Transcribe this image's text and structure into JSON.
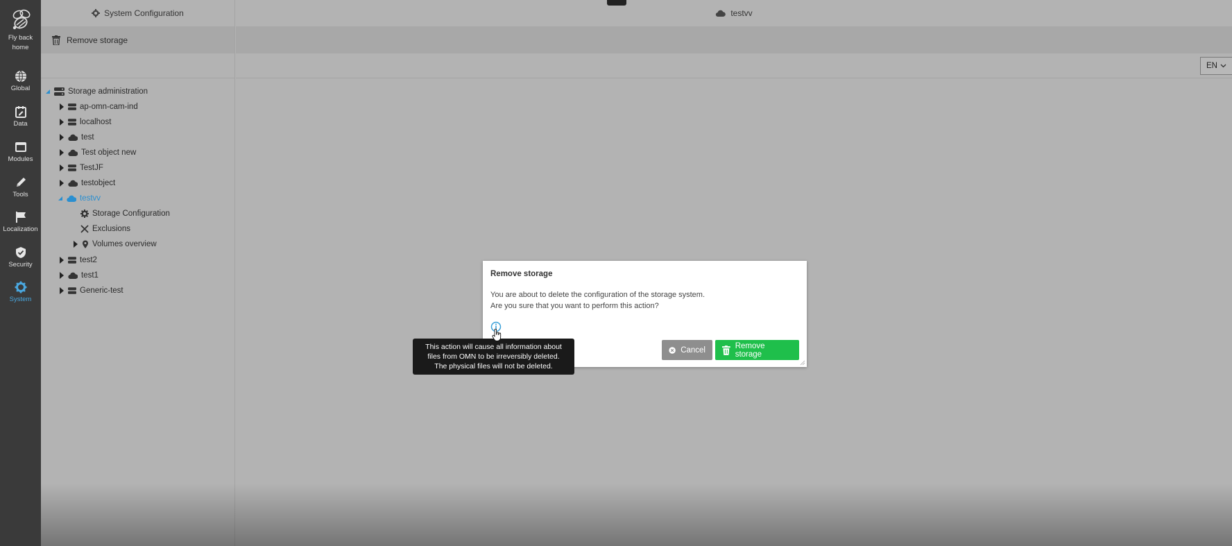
{
  "rail": {
    "logo_label": "Fly back home",
    "items": [
      {
        "label": "Global",
        "icon": "globe-icon"
      },
      {
        "label": "Data",
        "icon": "data-icon"
      },
      {
        "label": "Modules",
        "icon": "modules-icon"
      },
      {
        "label": "Tools",
        "icon": "pencil-icon"
      },
      {
        "label": "Localization",
        "icon": "flag-icon"
      },
      {
        "label": "Security",
        "icon": "shield-icon"
      },
      {
        "label": "System",
        "icon": "gear-icon"
      }
    ],
    "active": "System",
    "active_color": "#4aa8e0"
  },
  "left_panel": {
    "header_title": "System Configuration",
    "toolbar_action": "Remove storage",
    "tree": {
      "root": "Storage administration",
      "items": [
        {
          "label": "ap-omn-cam-ind",
          "icon": "server-icon"
        },
        {
          "label": "localhost",
          "icon": "server-icon"
        },
        {
          "label": "test",
          "icon": "cloud-icon"
        },
        {
          "label": "Test object new",
          "icon": "cloud-icon"
        },
        {
          "label": "TestJF",
          "icon": "server-icon"
        },
        {
          "label": "testobject",
          "icon": "cloud-icon"
        },
        {
          "label": "testvv",
          "icon": "cloud-icon",
          "selected": true,
          "children": [
            {
              "label": "Storage Configuration",
              "icon": "gear-icon"
            },
            {
              "label": "Exclusions",
              "icon": "close-icon"
            },
            {
              "label": "Volumes overview",
              "icon": "pin-icon"
            }
          ]
        },
        {
          "label": "test2",
          "icon": "server-icon"
        },
        {
          "label": "test1",
          "icon": "cloud-icon"
        },
        {
          "label": "Generic-test",
          "icon": "server-icon"
        }
      ]
    }
  },
  "main": {
    "header_title": "testvv",
    "language": "EN"
  },
  "dialog": {
    "title": "Remove storage",
    "message_line1": "You are about to delete the configuration of the storage system.",
    "message_line2": "Are you sure that you want to perform this action?",
    "cancel_label": "Cancel",
    "confirm_label": "Remove storage",
    "confirm_color": "#1fbf4b",
    "cancel_color": "#8e8e8e"
  },
  "tooltip": {
    "line1": "This action will cause all information about",
    "line2": "files from OMN to be irreversibly deleted.",
    "line3": "The physical files will not be deleted."
  }
}
